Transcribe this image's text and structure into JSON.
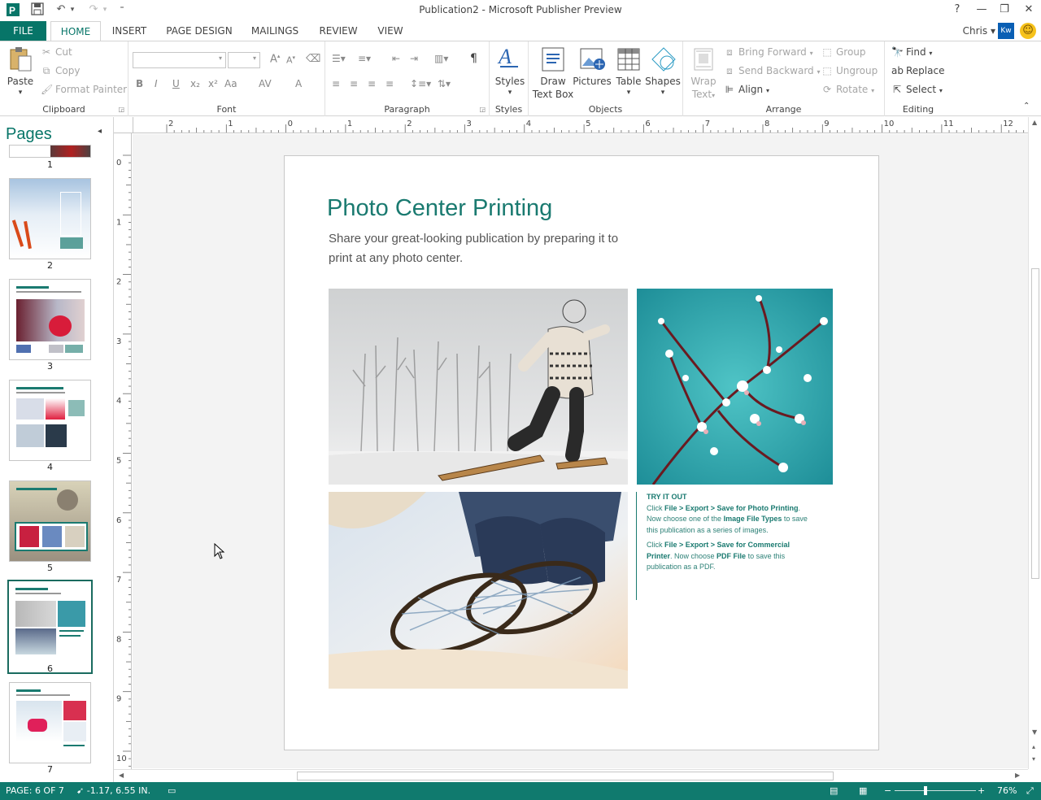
{
  "window": {
    "title": "Publication2 - Microsoft Publisher Preview",
    "help": "?",
    "minimize": "—",
    "restore": "❐",
    "close": "✕"
  },
  "qat": {
    "app_icon": "publisher-icon",
    "save": "💾",
    "undo": "↶",
    "undo_dropdown": "▾",
    "redo": "↷",
    "redo_dropdown": "▾",
    "customize": "⁼"
  },
  "tabs": {
    "file": "FILE",
    "items": [
      "HOME",
      "INSERT",
      "PAGE DESIGN",
      "MAILINGS",
      "REVIEW",
      "VIEW"
    ],
    "active": "HOME"
  },
  "user": {
    "name": "Chris",
    "avatar": "Kw"
  },
  "ribbon": {
    "clipboard": {
      "label": "Clipboard",
      "paste": "Paste",
      "cut": "Cut",
      "copy": "Copy",
      "format_painter": "Format Painter"
    },
    "font": {
      "label": "Font",
      "font_name": "",
      "font_size": "",
      "bold": "B",
      "italic": "I",
      "underline": "U",
      "subscript": "x₂",
      "superscript": "x²",
      "change_case": "Aa",
      "spacing": "AV",
      "font_color": "A",
      "grow": "A",
      "shrink": "A"
    },
    "paragraph": {
      "label": "Paragraph",
      "pilcrow": "¶"
    },
    "styles": {
      "label": "Styles",
      "button": "Styles"
    },
    "objects": {
      "label": "Objects",
      "draw_text_box_1": "Draw",
      "draw_text_box_2": "Text Box",
      "pictures": "Pictures",
      "table": "Table",
      "shapes": "Shapes"
    },
    "arrange": {
      "label": "Arrange",
      "wrap_text_1": "Wrap",
      "wrap_text_2": "Text",
      "bring_forward": "Bring Forward",
      "send_backward": "Send Backward",
      "align": "Align",
      "group": "Group",
      "ungroup": "Ungroup",
      "rotate": "Rotate"
    },
    "editing": {
      "label": "Editing",
      "find": "Find",
      "replace": "Replace",
      "select": "Select"
    }
  },
  "pages_pane": {
    "title": "Pages",
    "collapse": "◂",
    "pages": [
      "1",
      "2",
      "3",
      "4",
      "5",
      "6",
      "7"
    ],
    "selected": "6"
  },
  "ruler": {
    "h_labels": [
      "2",
      "1",
      "0",
      "1",
      "2",
      "3",
      "4",
      "5",
      "6",
      "7",
      "8",
      "9",
      "10",
      "11",
      "12"
    ],
    "v_labels": [
      "0",
      "1",
      "2",
      "3",
      "4",
      "5",
      "6",
      "7",
      "8",
      "9",
      "10"
    ]
  },
  "document": {
    "title": "Photo Center Printing",
    "subtitle": "Share your great-looking publication by preparing it to print at any photo center.",
    "try_title": "TRY IT OUT",
    "try_p1_a": "Click ",
    "try_p1_b": "File > Export > Save for Photo Printing",
    "try_p1_c": ". Now choose one of the ",
    "try_p1_d": "Image File Types",
    "try_p1_e": " to save this publication as a series of images.",
    "try_p2_a": "Click ",
    "try_p2_b": "File > Export > Save for Commercial Printer",
    "try_p2_c": ". Now choose ",
    "try_p2_d": "PDF File",
    "try_p2_e": " to save this publication as a PDF."
  },
  "statusbar": {
    "page": "PAGE: 6 OF 7",
    "position": "-1.17, 6.55 IN.",
    "zoom": "76%",
    "zoom_level": 0.76,
    "zoom_minus": "−",
    "zoom_plus": "+"
  },
  "colors": {
    "accent": "#077568",
    "doc_teal": "#1a7a70",
    "status": "#107a6e"
  }
}
